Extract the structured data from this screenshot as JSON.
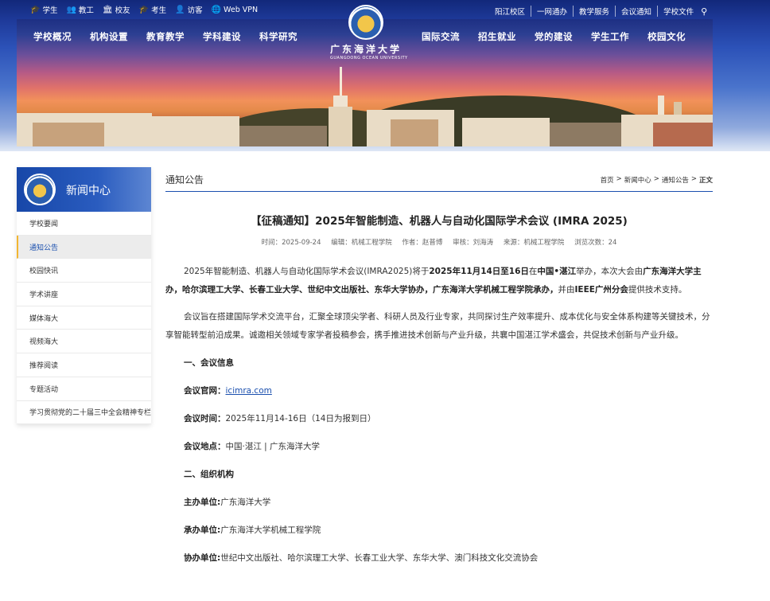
{
  "topbar": {
    "left_links": [
      {
        "icon": "graduation-cap-icon",
        "glyph": "🎓",
        "label": "学生"
      },
      {
        "icon": "users-icon",
        "glyph": "👥",
        "label": "教工"
      },
      {
        "icon": "alumni-icon",
        "glyph": "🏛",
        "label": "校友"
      },
      {
        "icon": "graduation-cap-icon",
        "glyph": "🎓",
        "label": "考生"
      },
      {
        "icon": "visitor-icon",
        "glyph": "👤",
        "label": "访客"
      },
      {
        "icon": "globe-icon",
        "glyph": "🌐",
        "label": "Web VPN"
      }
    ],
    "right_links": [
      "阳江校区",
      "一网通办",
      "教学服务",
      "会议通知",
      "学校文件"
    ]
  },
  "logo": {
    "cn": "广东海洋大学",
    "en": "GUANGDONG OCEAN UNIVERSITY"
  },
  "nav_left": [
    "学校概况",
    "机构设置",
    "教育教学",
    "学科建设",
    "科学研究"
  ],
  "nav_right": [
    "国际交流",
    "招生就业",
    "党的建设",
    "学生工作",
    "校园文化"
  ],
  "sidebar": {
    "title": "新闻中心",
    "items": [
      {
        "label": "学校要闻",
        "active": false
      },
      {
        "label": "通知公告",
        "active": true
      },
      {
        "label": "校园快讯",
        "active": false
      },
      {
        "label": "学术讲座",
        "active": false
      },
      {
        "label": "媒体海大",
        "active": false
      },
      {
        "label": "视频海大",
        "active": false
      },
      {
        "label": "推荐阅读",
        "active": false
      },
      {
        "label": "专题活动",
        "active": false
      },
      {
        "label": "学习贯彻党的二十届三中全会精神专栏",
        "active": false
      }
    ]
  },
  "section": {
    "title": "通知公告",
    "breadcrumb": [
      "首页",
      ">",
      "新闻中心",
      ">",
      "通知公告",
      ">",
      "正文"
    ]
  },
  "article": {
    "title": "【征稿通知】2025年智能制造、机器人与自动化国际学术会议 (IMRA 2025)",
    "meta": {
      "time": "时间：2025-09-24",
      "editor": "编辑：机械工程学院",
      "author": "作者：赵普博",
      "reviewer": "审核：刘海涛",
      "source": "来源：机械工程学院",
      "views": "浏览次数：24"
    },
    "p1": {
      "a": "2025年智能制造、机器人与自动化国际学术会议(IMRA2025)将于",
      "b": "2025年11月14日至16日",
      "c": "在",
      "d": "中国•湛江",
      "e": "举办，本次大会由",
      "f": "广东海洋大学主办，哈尔滨理工大学、长春工业大学、世纪中文出版社、东华大学协办，广东海洋大学机械工程学院承办，",
      "g": "并由",
      "h": "IEEE广州分会",
      "i": "提供技术支持。"
    },
    "p2": "会议旨在搭建国际学术交流平台，汇聚全球顶尖学者、科研人员及行业专家，共同探讨生产效率提升、成本优化与安全体系构建等关键技术，分享智能转型前沿成果。诚邀相关领域专家学者投稿参会，携手推进技术创新与产业升级，共襄中国湛江学术盛会，共促技术创新与产业升级。",
    "sec1": "一、会议信息",
    "website_label": "会议官网：",
    "website_value": "icimra.com",
    "time_label": "会议时间：",
    "time_value": "2025年11月14-16日（14日为报到日）",
    "place_label": "会议地点：",
    "place_value": "中国·湛江 | 广东海洋大学",
    "sec2": "二、组织机构",
    "host_label": "主办单位:",
    "host_value": "广东海洋大学",
    "organizer_label": "承办单位:",
    "organizer_value": "广东海洋大学机械工程学院",
    "co_label": "协办单位:",
    "co_value": "世纪中文出版社、哈尔滨理工大学、长春工业大学、东华大学、澳门科技文化交流协会"
  }
}
